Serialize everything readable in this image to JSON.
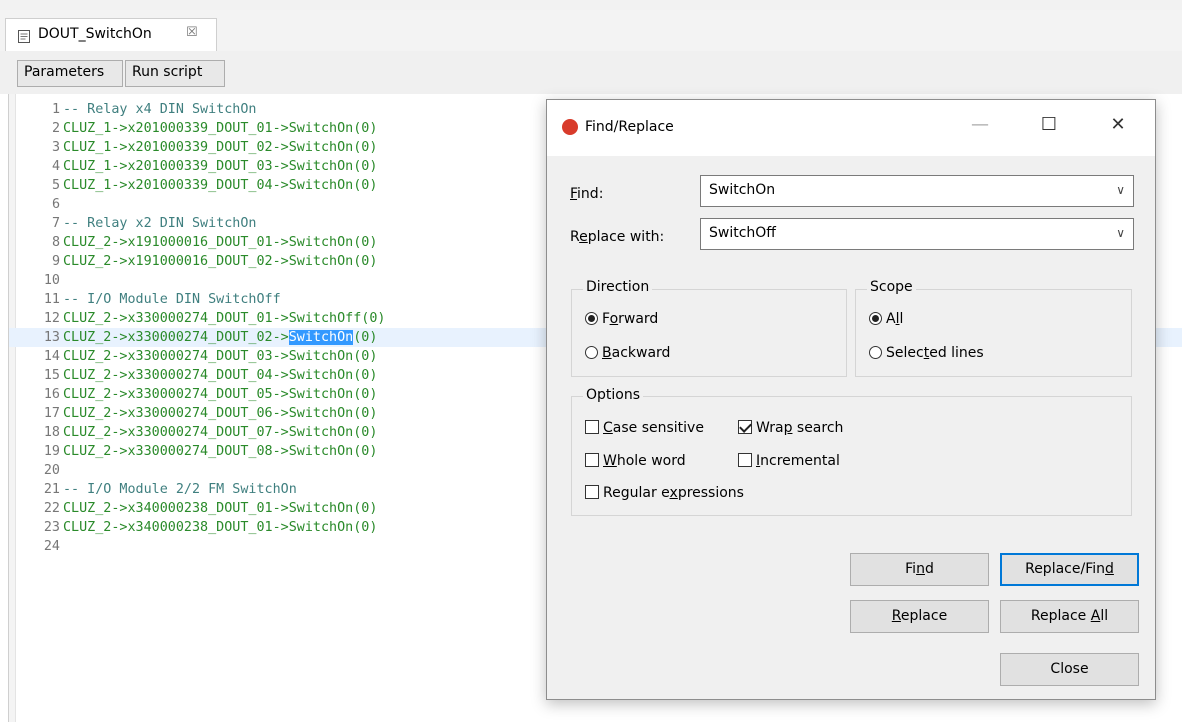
{
  "editor_tab": {
    "title": "DOUT_SwitchOn",
    "close_glyph": "☒"
  },
  "toolbar": {
    "parameters_label": "Parameters",
    "run_script_label": "Run script"
  },
  "code_lines": [
    {
      "n": "1",
      "text": "-- Relay x4 DIN SwitchOn",
      "kind": "comment"
    },
    {
      "n": "2",
      "text": "CLUZ_1->x201000339_DOUT_01->SwitchOn(0)",
      "kind": "code"
    },
    {
      "n": "3",
      "text": "CLUZ_1->x201000339_DOUT_02->SwitchOn(0)",
      "kind": "code"
    },
    {
      "n": "4",
      "text": "CLUZ_1->x201000339_DOUT_03->SwitchOn(0)",
      "kind": "code"
    },
    {
      "n": "5",
      "text": "CLUZ_1->x201000339_DOUT_04->SwitchOn(0)",
      "kind": "code"
    },
    {
      "n": "6",
      "text": "",
      "kind": "code"
    },
    {
      "n": "7",
      "text": "-- Relay x2 DIN SwitchOn",
      "kind": "comment"
    },
    {
      "n": "8",
      "text": "CLUZ_2->x191000016_DOUT_01->SwitchOn(0)",
      "kind": "code"
    },
    {
      "n": "9",
      "text": "CLUZ_2->x191000016_DOUT_02->SwitchOn(0)",
      "kind": "code"
    },
    {
      "n": "10",
      "text": "",
      "kind": "code"
    },
    {
      "n": "11",
      "text": "-- I/O Module DIN SwitchOff",
      "kind": "comment"
    },
    {
      "n": "12",
      "text": "CLUZ_2->x330000274_DOUT_01->SwitchOff(0)",
      "kind": "code"
    },
    {
      "n": "13",
      "text": "CLUZ_2->x330000274_DOUT_02->",
      "kind": "code",
      "selected": "SwitchOn",
      "after": "(0)"
    },
    {
      "n": "14",
      "text": "CLUZ_2->x330000274_DOUT_03->SwitchOn(0)",
      "kind": "code"
    },
    {
      "n": "15",
      "text": "CLUZ_2->x330000274_DOUT_04->SwitchOn(0)",
      "kind": "code"
    },
    {
      "n": "16",
      "text": "CLUZ_2->x330000274_DOUT_05->SwitchOn(0)",
      "kind": "code"
    },
    {
      "n": "17",
      "text": "CLUZ_2->x330000274_DOUT_06->SwitchOn(0)",
      "kind": "code"
    },
    {
      "n": "18",
      "text": "CLUZ_2->x330000274_DOUT_07->SwitchOn(0)",
      "kind": "code"
    },
    {
      "n": "19",
      "text": "CLUZ_2->x330000274_DOUT_08->SwitchOn(0)",
      "kind": "code"
    },
    {
      "n": "20",
      "text": "",
      "kind": "code"
    },
    {
      "n": "21",
      "text": "-- I/O Module 2/2 FM SwitchOn",
      "kind": "comment"
    },
    {
      "n": "22",
      "text": "CLUZ_2->x340000238_DOUT_01->SwitchOn(0)",
      "kind": "code"
    },
    {
      "n": "23",
      "text": "CLUZ_2->x340000238_DOUT_01->SwitchOn(0)",
      "kind": "code"
    },
    {
      "n": "24",
      "text": "",
      "kind": "code"
    }
  ],
  "dialog": {
    "title": "Find/Replace",
    "minimize_glyph": "—",
    "maximize_glyph": "☐",
    "close_glyph": "✕",
    "find_label": {
      "pre": "",
      "key": "F",
      "post": "ind:"
    },
    "find_value": "SwitchOn",
    "replace_label": {
      "pre": "R",
      "key": "e",
      "post": "place with:"
    },
    "replace_value": "SwitchOff",
    "direction": {
      "title": "Direction",
      "forward": {
        "pre": "F",
        "key": "o",
        "post": "rward",
        "checked": true
      },
      "backward": {
        "pre": "",
        "key": "B",
        "post": "ackward",
        "checked": false
      }
    },
    "scope": {
      "title": "Scope",
      "all": {
        "pre": "A",
        "key": "l",
        "post": "l",
        "checked": true
      },
      "selected_lines": {
        "pre": "Selec",
        "key": "t",
        "post": "ed lines",
        "checked": false
      }
    },
    "options": {
      "title": "Options",
      "case_sensitive": {
        "pre": "",
        "key": "C",
        "post": "ase sensitive",
        "checked": false
      },
      "wrap_search": {
        "pre": "Wra",
        "key": "p",
        "post": " search",
        "checked": true
      },
      "whole_word": {
        "pre": "",
        "key": "W",
        "post": "hole word",
        "checked": false
      },
      "incremental": {
        "pre": "",
        "key": "I",
        "post": "ncremental",
        "checked": false
      },
      "regular_expressions": {
        "pre": "Regular e",
        "key": "x",
        "post": "pressions",
        "checked": false
      }
    },
    "buttons": {
      "find": {
        "pre": "Fi",
        "key": "n",
        "post": "d"
      },
      "replace_find": {
        "pre": "Replace/Fin",
        "key": "d",
        "post": ""
      },
      "replace": {
        "pre": "",
        "key": "R",
        "post": "eplace"
      },
      "replace_all": {
        "pre": "Replace ",
        "key": "A",
        "post": "ll"
      },
      "close": {
        "pre": "Close",
        "key": "",
        "post": ""
      }
    }
  },
  "colors": {
    "comment": "#3f7f7f",
    "code": "#2a8a2a",
    "selection": "#3399ff",
    "current_line": "#e8f2fe",
    "default_button_border": "#0078d7"
  }
}
